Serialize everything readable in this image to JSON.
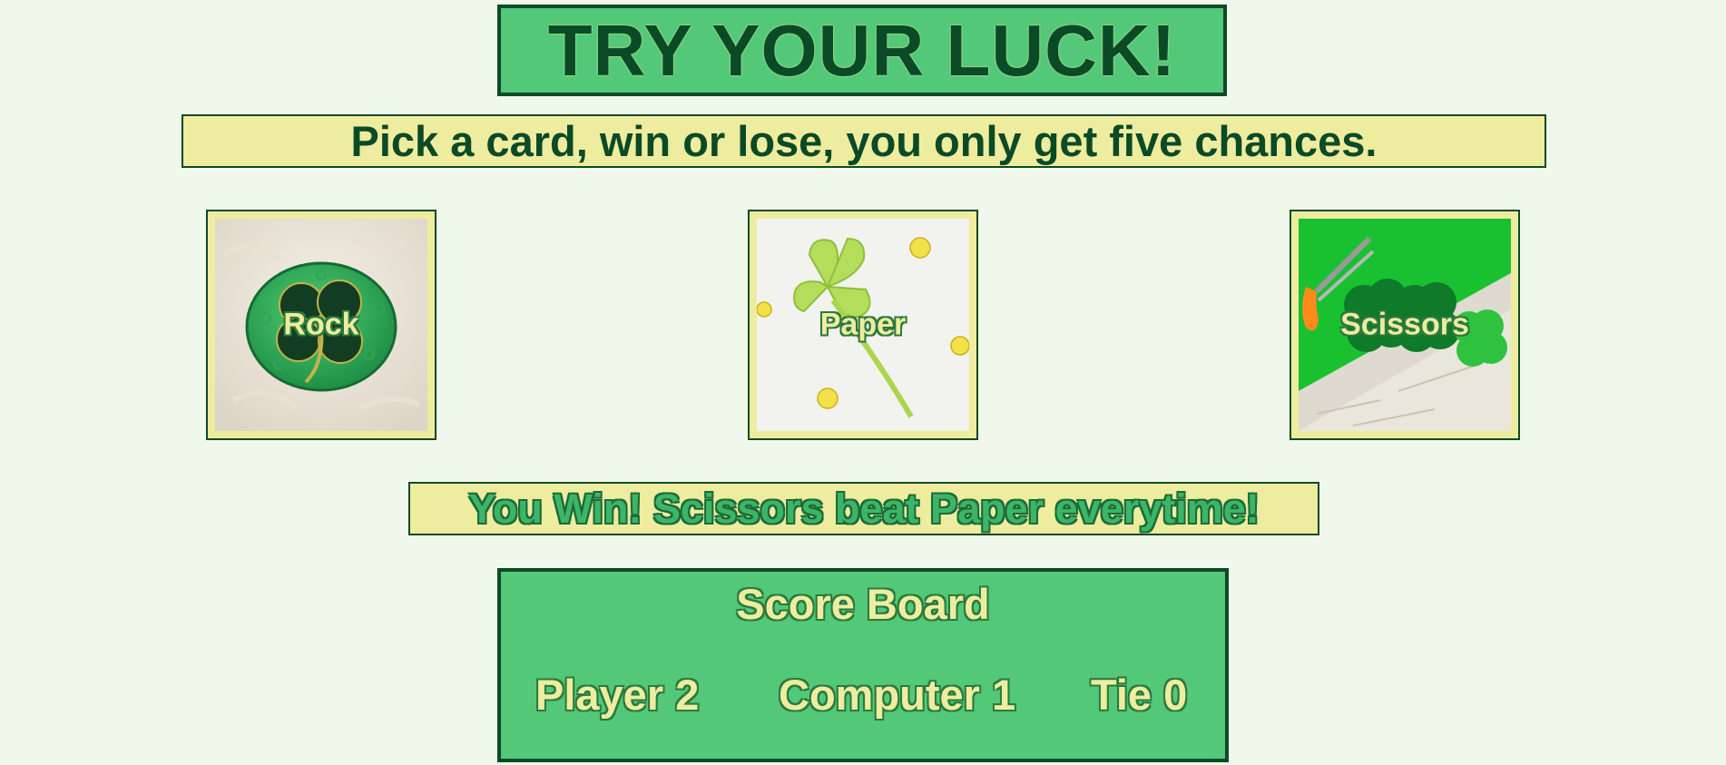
{
  "header": {
    "title": "TRY YOUR LUCK!"
  },
  "instructions": {
    "text": "Pick a card, win or lose, you only get five chances."
  },
  "cards": [
    {
      "label": "Rock"
    },
    {
      "label": "Paper"
    },
    {
      "label": "Scissors"
    }
  ],
  "result": {
    "message": "You Win! Scissors beat Paper everytime!"
  },
  "scoreboard": {
    "title": "Score Board",
    "player": {
      "label": "Player",
      "value": "2"
    },
    "computer": {
      "label": "Computer",
      "value": "1"
    },
    "tie": {
      "label": "Tie",
      "value": "0"
    }
  },
  "colors": {
    "background": "#f0f8ec",
    "green_panel": "#52c878",
    "dark_green": "#0d4a27",
    "cream": "#eeec9f"
  }
}
